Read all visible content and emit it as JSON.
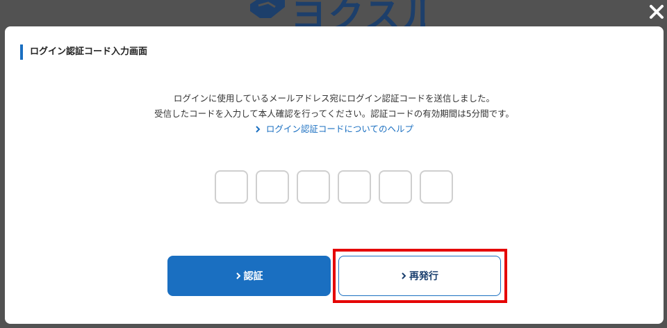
{
  "background": {
    "logo_text": "ヨクスル"
  },
  "modal": {
    "title": "ログイン認証コード入力画面",
    "message_line1": "ログインに使用しているメールアドレス宛にログイン認証コードを送信しました。",
    "message_line2": "受信したコードを入力して本人確認を行ってください。認証コードの有効期間は5分間です。",
    "help_link": "ログイン認証コードについてのヘルプ",
    "code_digits": [
      "",
      "",
      "",
      "",
      "",
      ""
    ],
    "verify_button": "認証",
    "resend_button": "再発行"
  },
  "icons": {
    "close": "close-icon",
    "link_chevron": "chevron-right-icon"
  },
  "colors": {
    "accent": "#1a6fc1",
    "highlight": "#e50000",
    "overlay": "#525252"
  }
}
